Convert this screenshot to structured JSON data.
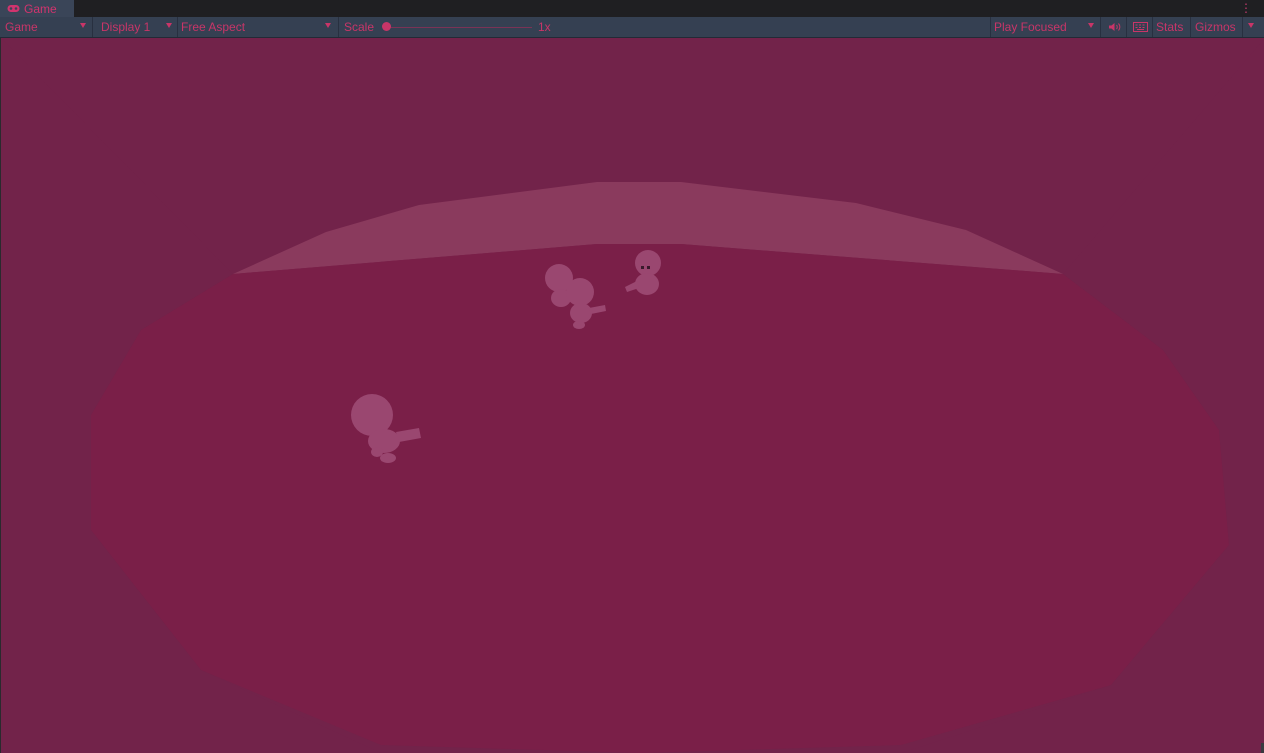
{
  "tab": {
    "icon": "game-controller-icon",
    "label": "Game"
  },
  "menu_icon": "kebab-menu-icon",
  "toolbar": {
    "mode": "Game",
    "display": "Display 1",
    "aspect": "Free Aspect",
    "scale_label": "Scale",
    "scale_value": "1x",
    "play_mode": "Play Focused",
    "mute_icon": "speaker-icon",
    "keyboard_icon": "keyboard-icon",
    "stats": "Stats",
    "gizmos": "Gizmos"
  },
  "colors": {
    "accent_text": "#c93568",
    "toolbar_bg": "#354052",
    "view_bg": "#72234a",
    "arena_floor": "#7a1f48",
    "arena_wall": "#8a3a5d",
    "character": "#9a4770"
  },
  "scene": {
    "characters": 4,
    "arena": "octagon"
  }
}
